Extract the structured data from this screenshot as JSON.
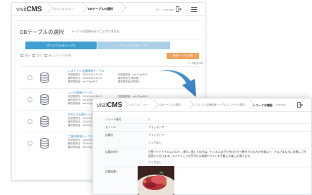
{
  "back_window": {
    "logo_prefix": "visit",
    "logo_main": "CMS",
    "breadcrumb": [
      "メインメニュー",
      "DBテーブルの選択"
    ],
    "user": "ID：--manage",
    "page_title": "DBテーブルの選択",
    "page_subtitle": "テーブルの管理を行うことができます。",
    "tabs": [
      "オリジナルDBテーブル",
      "デフォルトDBテーブル"
    ],
    "toolbar": [
      "既存",
      "空白",
      "新しいテーブル作成"
    ],
    "add_button": "新規テーブル作成",
    "count": "1〜4件目/4件",
    "rows": [
      {
        "name": "レストラン店舗情報テーブル",
        "created": "初回登録日：2016/10/13 10:26",
        "updated": "最終更新日：2016/10/13 10:33",
        "updater": "最終更新者：ae137gm815",
        "first_by": "初回登録者：ae137gm815",
        "last_by": "最終更新日(承認前)：-",
        "last_by2": "最終更新者(承認前)：-"
      },
      {
        "name": "レシピ情報テーブル",
        "created": "初回登録日：2016/10/13 10:27",
        "updated": "最終更新日：2016/10/13 10:28",
        "updater": "最終更新者：ae137gm815",
        "first_by": "初回登録者：ae137gm815",
        "last_by": "最終更新日(承認前)：-",
        "last_by2": "最終更新者(承認前)：-"
      },
      {
        "name": "お知らせ記事テーブル",
        "created": "初回登録日：2016/10/13 1",
        "updated": "最終更新日：2016/10/13 1",
        "updater": "最終更新者：ae137gm815",
        "first_by": "",
        "last_by": "",
        "last_by2": ""
      },
      {
        "name": "ご優待情報テーブル",
        "created": "初回登録日：2016/10/13 1",
        "updated": "最終更新日：2016/10/13 1",
        "updater": "最終更新者：ae137gm815",
        "first_by": "",
        "last_by": "",
        "last_by2": ""
      }
    ]
  },
  "front_window": {
    "logo_prefix": "visit",
    "logo_main": "CMS",
    "breadcrumb": [
      "メインメニュー",
      "DBテーブルの選択",
      "レストラン店舗情報テーブル レコードの選択",
      "レコードの確認"
    ],
    "user": "ID：--manage",
    "rows": [
      {
        "key": "レコード番号",
        "value": "2"
      },
      {
        "key": "タイトル",
        "value": "ブラッディア"
      },
      {
        "key": "店舗名",
        "value": "ブラッディア"
      },
      {
        "key": "",
        "value": "リンクなし"
      },
      {
        "key": "店舗の紹介",
        "value": "日替ワイビトトルスパロイ。通りに面した店内は、ビジネスの打ち合わせから観光される方の作業まで、さまざまな方に気軽にご利用頂いております。ステキシェフが手がける料理やワインを手軽にお楽しみ頂けます。"
      },
      {
        "key": "",
        "value": "リンクなし"
      },
      {
        "key": "店舗画像1",
        "value": ""
      }
    ]
  },
  "colors": {
    "accent_blue": "#3f9fd1",
    "tab_inactive": "#a9d0e8",
    "orange": "#f0a35d",
    "link": "#3f8fc4"
  },
  "icons": [
    "database-icon",
    "user-icon",
    "logout-icon",
    "menu-icon",
    "arrow-curve-icon"
  ]
}
